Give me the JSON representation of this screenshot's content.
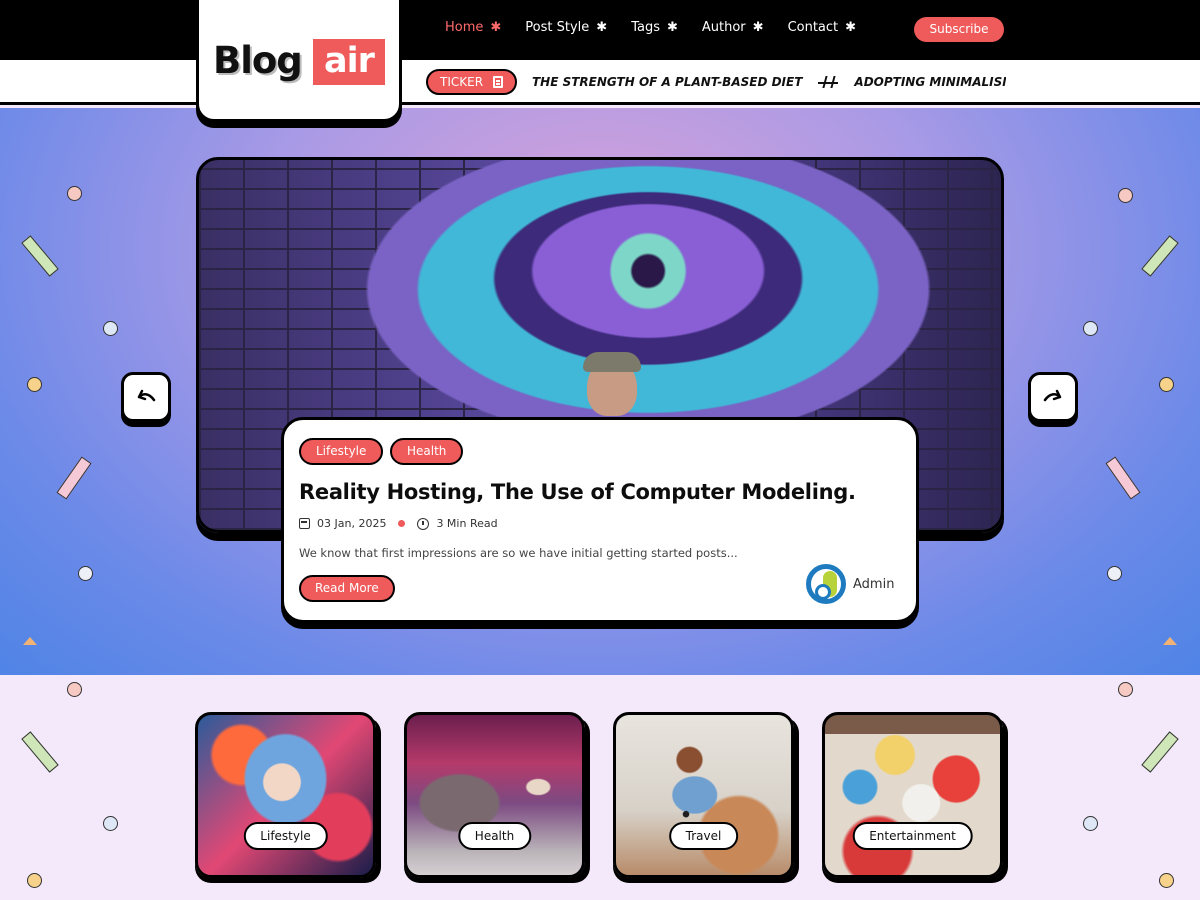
{
  "header": {
    "logo": {
      "text_part_1": "Blog",
      "text_part_2": "air"
    },
    "nav": [
      {
        "label": "Home",
        "active": true
      },
      {
        "label": "Post Style",
        "active": false
      },
      {
        "label": "Tags",
        "active": false
      },
      {
        "label": "Author",
        "active": false
      },
      {
        "label": "Contact",
        "active": false
      }
    ],
    "subscribe_label": "Subscribe"
  },
  "ticker": {
    "label": "TICKER",
    "items": [
      "THE STRENGTH OF A PLANT-BASED DIET",
      "ADOPTING MINIMALISM: S"
    ]
  },
  "hero": {
    "tags": [
      "Lifestyle",
      "Health"
    ],
    "title": "Reality Hosting, The Use of Computer Modeling.",
    "date": "03 Jan, 2025",
    "read_time": "3 Min Read",
    "excerpt": "We know that first impressions are so we have initial getting started posts...",
    "read_more_label": "Read More",
    "author": "Admin"
  },
  "categories": [
    {
      "label": "Lifestyle"
    },
    {
      "label": "Health"
    },
    {
      "label": "Travel"
    },
    {
      "label": "Entertainment"
    }
  ],
  "colors": {
    "accent": "#ef5a5a",
    "header_bg": "#000000",
    "categories_bg": "#f4e9fb"
  },
  "icons": [
    "star-icon",
    "document-icon",
    "calendar-icon",
    "clock-icon",
    "arrow-left-icon",
    "arrow-right-icon"
  ]
}
